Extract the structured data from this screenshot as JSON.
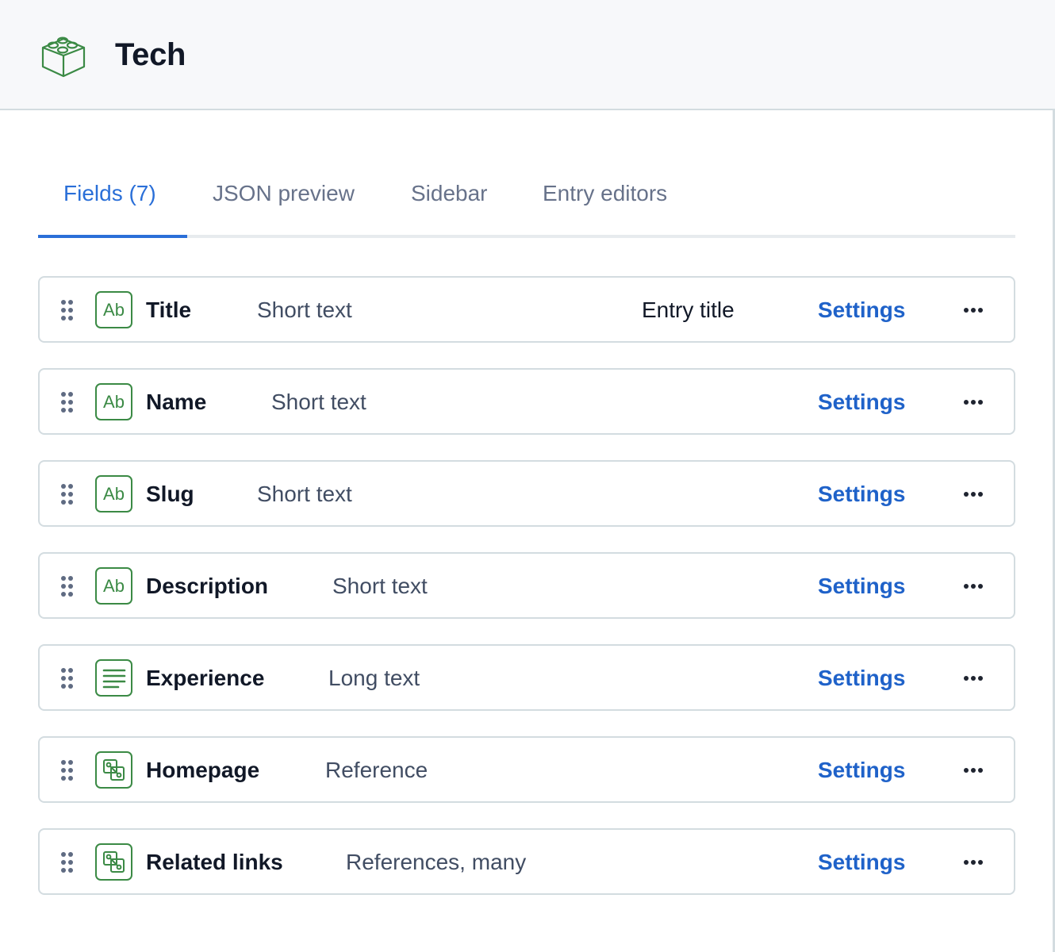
{
  "header": {
    "title": "Tech",
    "icon": "content-type-block-icon"
  },
  "tabs": [
    {
      "label": "Fields (7)",
      "active": true
    },
    {
      "label": "JSON preview",
      "active": false
    },
    {
      "label": "Sidebar",
      "active": false
    },
    {
      "label": "Entry editors",
      "active": false
    }
  ],
  "fields": [
    {
      "name": "Title",
      "type": "Short text",
      "icon": "short-text-icon",
      "icon_text": "Ab",
      "badge": "Entry title",
      "settings_label": "Settings",
      "more_label": "More actions"
    },
    {
      "name": "Name",
      "type": "Short text",
      "icon": "short-text-icon",
      "icon_text": "Ab",
      "badge": "",
      "settings_label": "Settings",
      "more_label": "More actions"
    },
    {
      "name": "Slug",
      "type": "Short text",
      "icon": "short-text-icon",
      "icon_text": "Ab",
      "badge": "",
      "settings_label": "Settings",
      "more_label": "More actions"
    },
    {
      "name": "Description",
      "type": "Short text",
      "icon": "short-text-icon",
      "icon_text": "Ab",
      "badge": "",
      "settings_label": "Settings",
      "more_label": "More actions"
    },
    {
      "name": "Experience",
      "type": "Long text",
      "icon": "long-text-icon",
      "icon_text": "",
      "badge": "",
      "settings_label": "Settings",
      "more_label": "More actions"
    },
    {
      "name": "Homepage",
      "type": "Reference",
      "icon": "reference-icon",
      "icon_text": "",
      "badge": "",
      "settings_label": "Settings",
      "more_label": "More actions"
    },
    {
      "name": "Related links",
      "type": "References, many",
      "icon": "reference-icon",
      "icon_text": "",
      "badge": "",
      "settings_label": "Settings",
      "more_label": "More actions"
    }
  ],
  "colors": {
    "accent": "#2a6fd8",
    "link": "#1f62c9",
    "icon_green": "#3b8a45",
    "header_bg": "#f7f8fa",
    "border": "#d3dce0"
  }
}
